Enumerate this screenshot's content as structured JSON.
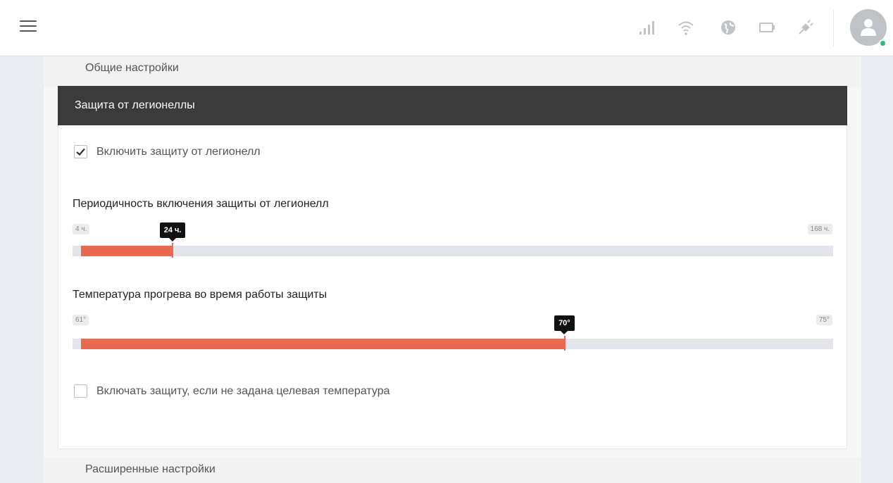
{
  "topbar": {
    "menu_icon": "hamburger-menu-icon",
    "status_icons": [
      "signal-icon",
      "wifi-icon",
      "globe-icon",
      "battery-icon",
      "plug-icon"
    ],
    "avatar_icon": "user-icon",
    "status_color": "#36b37e"
  },
  "sections": {
    "general": "Общие настройки",
    "legionella": "Защита от легионеллы",
    "advanced": "Расширенные настройки"
  },
  "legionella": {
    "enable_label": "Включить защиту от легионелл",
    "enable_checked": true,
    "period": {
      "title": "Периодичность включения защиты от легионелл",
      "min_label": "4 ч.",
      "max_label": "168 ч.",
      "value_label": "24 ч.",
      "min": 4,
      "max": 168,
      "value": 24
    },
    "temperature": {
      "title": "Температура прогрева во время работы защиты",
      "min_label": "61°",
      "max_label": "75°",
      "value_label": "70°",
      "min": 61,
      "max": 75,
      "value": 70
    },
    "no_target_label": "Включать защиту, если не задана целевая температура",
    "no_target_checked": false
  },
  "colors": {
    "accent": "#e96a50",
    "header_bg": "#3b3b3b"
  }
}
